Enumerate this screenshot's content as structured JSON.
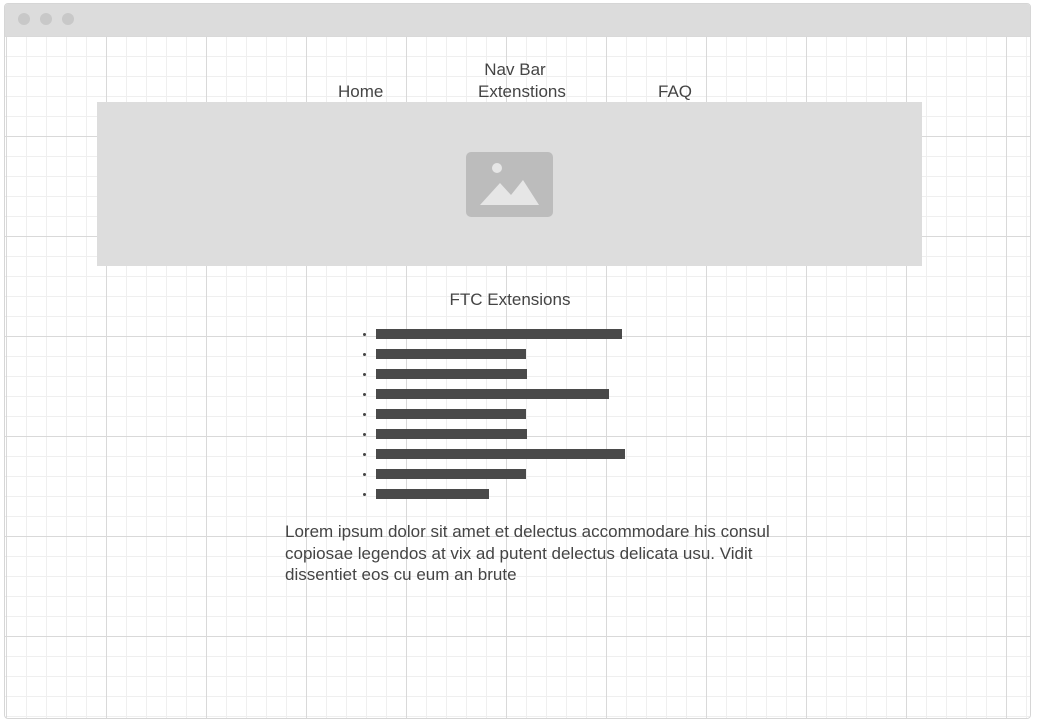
{
  "window": {
    "traffic_lights": [
      "window-dot",
      "window-dot",
      "window-dot"
    ]
  },
  "navbar": {
    "title": "Nav Bar",
    "links": [
      "Home",
      "Extenstions",
      "FAQ"
    ]
  },
  "hero": {
    "icon": "image-placeholder-icon"
  },
  "section": {
    "title": "FTC Extensions",
    "items": [
      {
        "length": 246
      },
      {
        "length": 150
      },
      {
        "length": 151
      },
      {
        "length": 233
      },
      {
        "length": 150
      },
      {
        "length": 151
      },
      {
        "length": 249
      },
      {
        "length": 150
      },
      {
        "length": 113
      }
    ]
  },
  "body": {
    "text": "Lorem ipsum dolor sit amet et delectus accommodare his consul copiosae legendos at vix ad putent delectus delicata usu. Vidit dissentiet eos cu eum an brute"
  },
  "colors": {
    "grid_major": "#d9d9d9",
    "grid_minor": "#efefef",
    "placeholder": "#dddddd",
    "text": "#444444",
    "bar": "#4a4a4a"
  }
}
